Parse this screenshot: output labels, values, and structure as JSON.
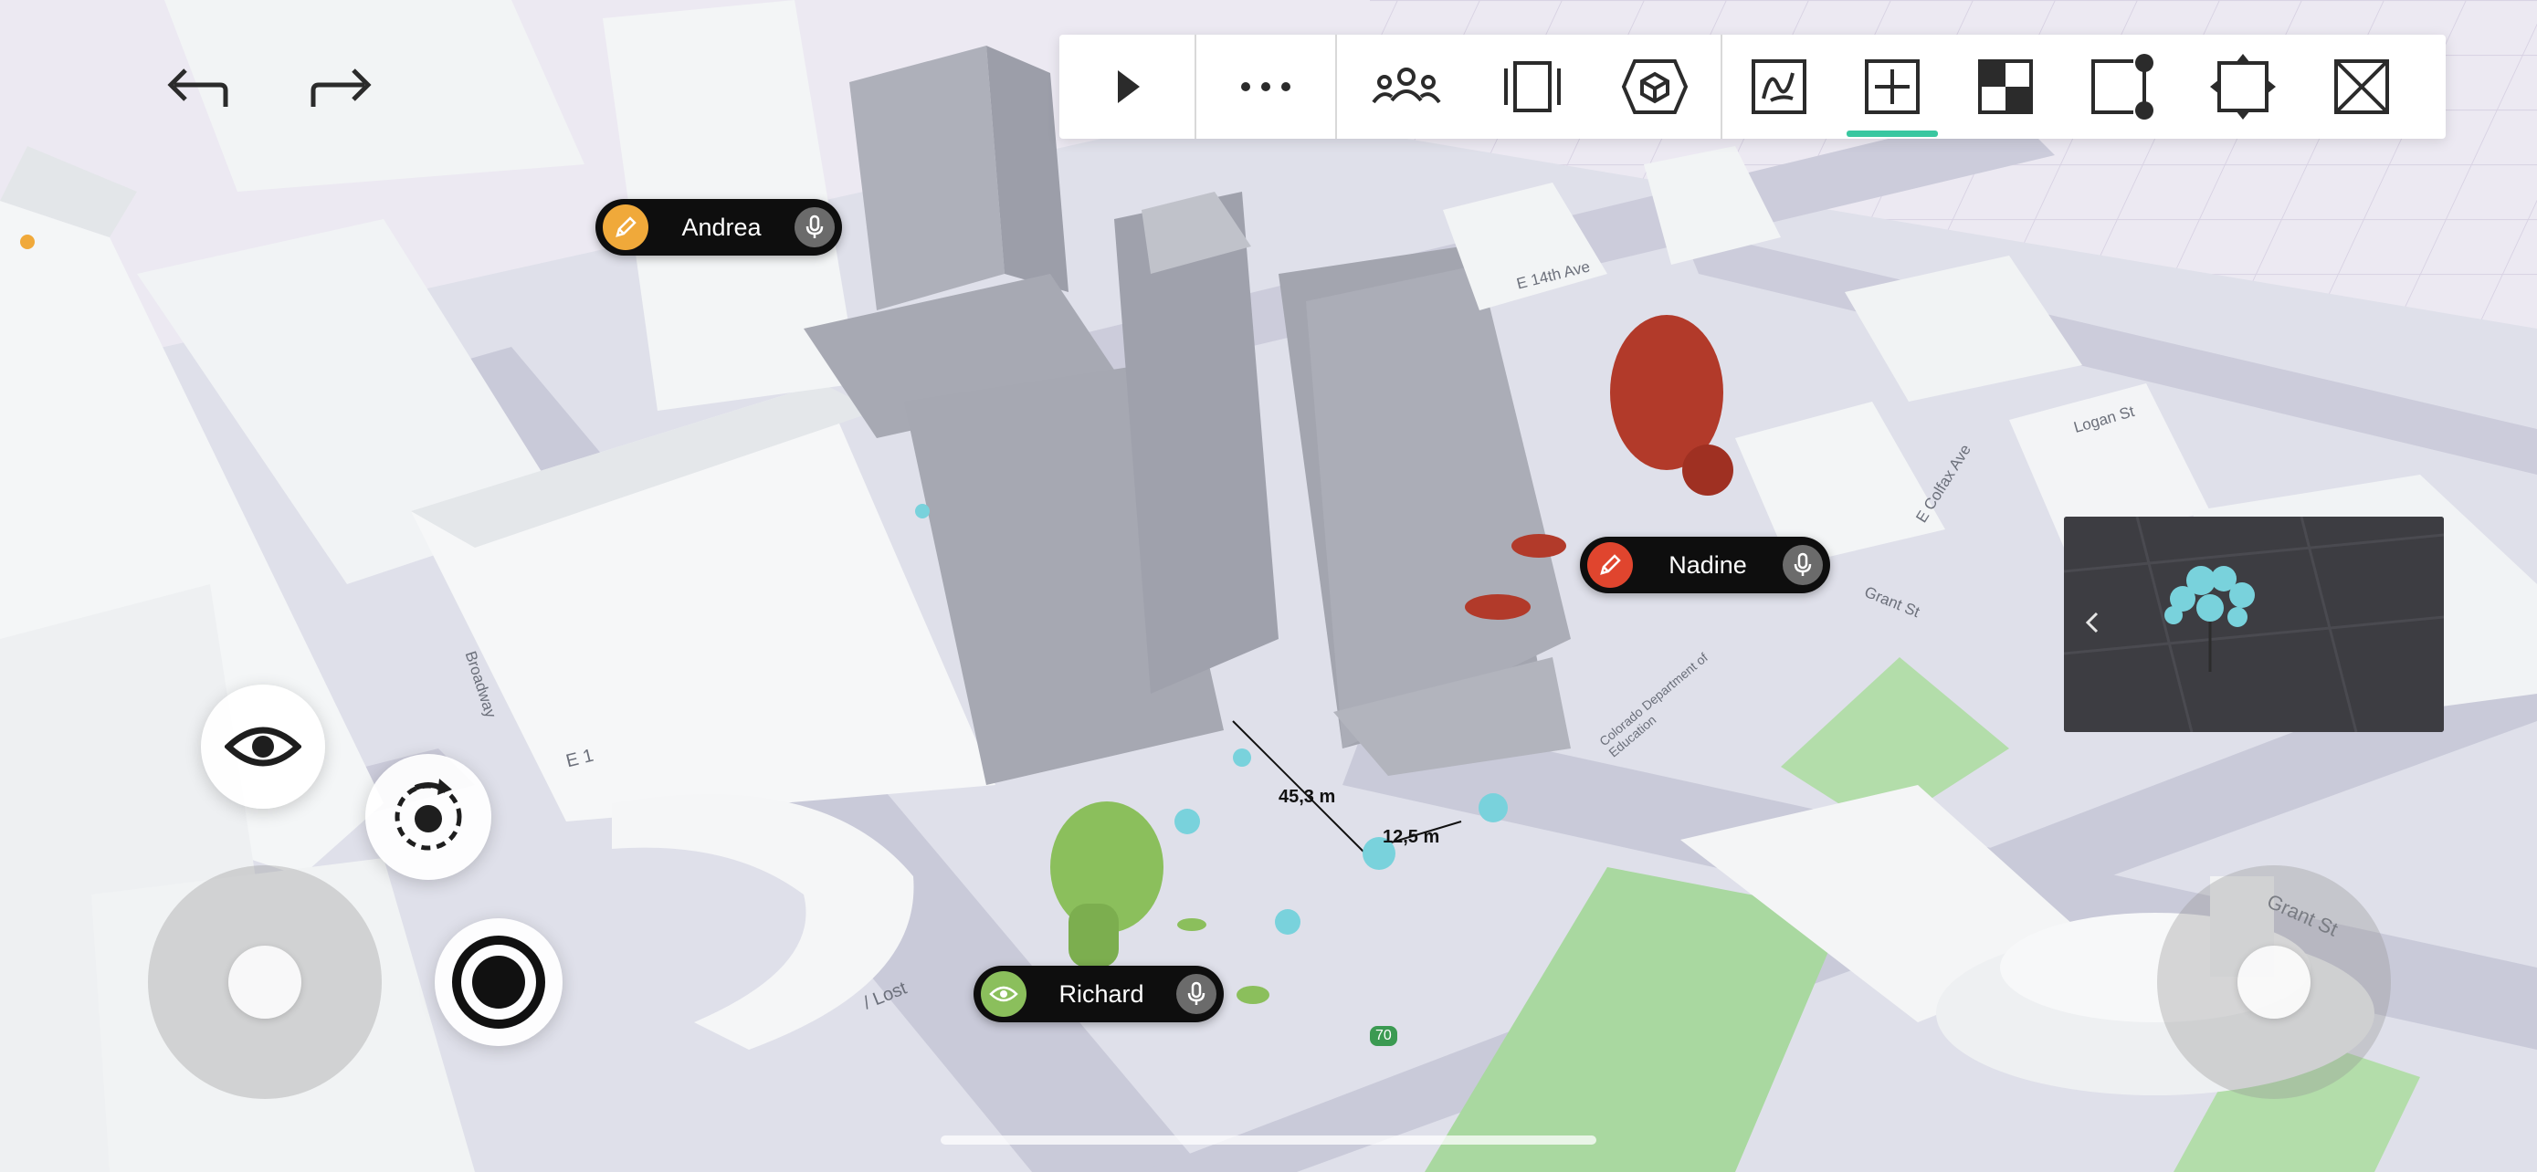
{
  "toolbar": {
    "buttons": [
      {
        "name": "play-icon"
      },
      {
        "name": "more-icon"
      },
      {
        "name": "collaborators-icon"
      },
      {
        "name": "presentation-frame-icon"
      },
      {
        "name": "ar-view-icon"
      },
      {
        "name": "sketch-icon"
      },
      {
        "name": "add-object-icon",
        "active": true
      },
      {
        "name": "material-icon"
      },
      {
        "name": "measure-tool-icon"
      },
      {
        "name": "fit-view-icon"
      },
      {
        "name": "close-icon"
      }
    ],
    "active_color": "#39c7a0"
  },
  "history": {
    "undo_icon": "undo-arrow-icon",
    "redo_icon": "redo-arrow-icon"
  },
  "collaborators": [
    {
      "name": "Andrea",
      "color": "#f0a93a",
      "icon": "pencil-icon"
    },
    {
      "name": "Nadine",
      "color": "#e0452e",
      "icon": "pencil-icon"
    },
    {
      "name": "Richard",
      "color": "#8bbf5c",
      "icon": "eye-icon"
    }
  ],
  "measurements": {
    "a": "45,3 m",
    "b": "12,5 m"
  },
  "streets": {
    "broadway": "Broadway",
    "e14": "E 14th Ave",
    "colfax": "E Colfax Ave",
    "logan": "Logan St",
    "grant": "Grant St",
    "grant2": "Grant St",
    "education": "Colorado Department of Education",
    "e1": "E 1",
    "lost": "/ Lost",
    "hwy": "70"
  },
  "colors": {
    "ground": "#e9e6ef",
    "road": "#c9cad9",
    "park": "#a9d8a0",
    "building": "#f2f4f5",
    "highlight_building": "#a9abb5"
  },
  "controls": {
    "eye_icon": "eye-icon",
    "orbit_icon": "orbit-rotate-icon",
    "record_icon": "record-icon"
  },
  "minimap": {
    "back_icon": "chevron-left-icon",
    "preview": "tree-model-preview"
  }
}
